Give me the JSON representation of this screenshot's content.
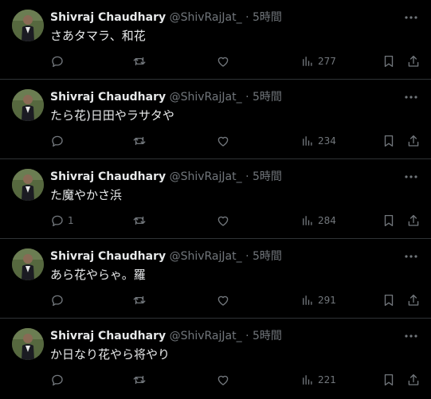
{
  "colors": {
    "background": "#000000",
    "text": "#e7e9ea",
    "muted": "#71767b",
    "divider": "#2f3336"
  },
  "icons": {
    "reply": "reply-icon",
    "retweet": "retweet-icon",
    "like": "like-icon",
    "views": "views-icon",
    "bookmark": "bookmark-icon",
    "share": "share-icon",
    "more": "more-icon"
  },
  "tweets": [
    {
      "name": "Shivraj Chaudhary",
      "handle": "@ShivRajJat_",
      "dot": "·",
      "time": "5時間",
      "text": "さあタマラ、和花",
      "replies": "",
      "views": "277"
    },
    {
      "name": "Shivraj Chaudhary",
      "handle": "@ShivRajJat_",
      "dot": "·",
      "time": "5時間",
      "text": "たら花)日田やラサタや",
      "replies": "",
      "views": "234"
    },
    {
      "name": "Shivraj Chaudhary",
      "handle": "@ShivRajJat_",
      "dot": "·",
      "time": "5時間",
      "text": "た魔やかさ浜",
      "replies": "1",
      "views": "284"
    },
    {
      "name": "Shivraj Chaudhary",
      "handle": "@ShivRajJat_",
      "dot": "·",
      "time": "5時間",
      "text": "あら花やらゃ。羅",
      "replies": "",
      "views": "291"
    },
    {
      "name": "Shivraj Chaudhary",
      "handle": "@ShivRajJat_",
      "dot": "·",
      "time": "5時間",
      "text": "か日なり花やら将やり",
      "replies": "",
      "views": "221"
    }
  ]
}
